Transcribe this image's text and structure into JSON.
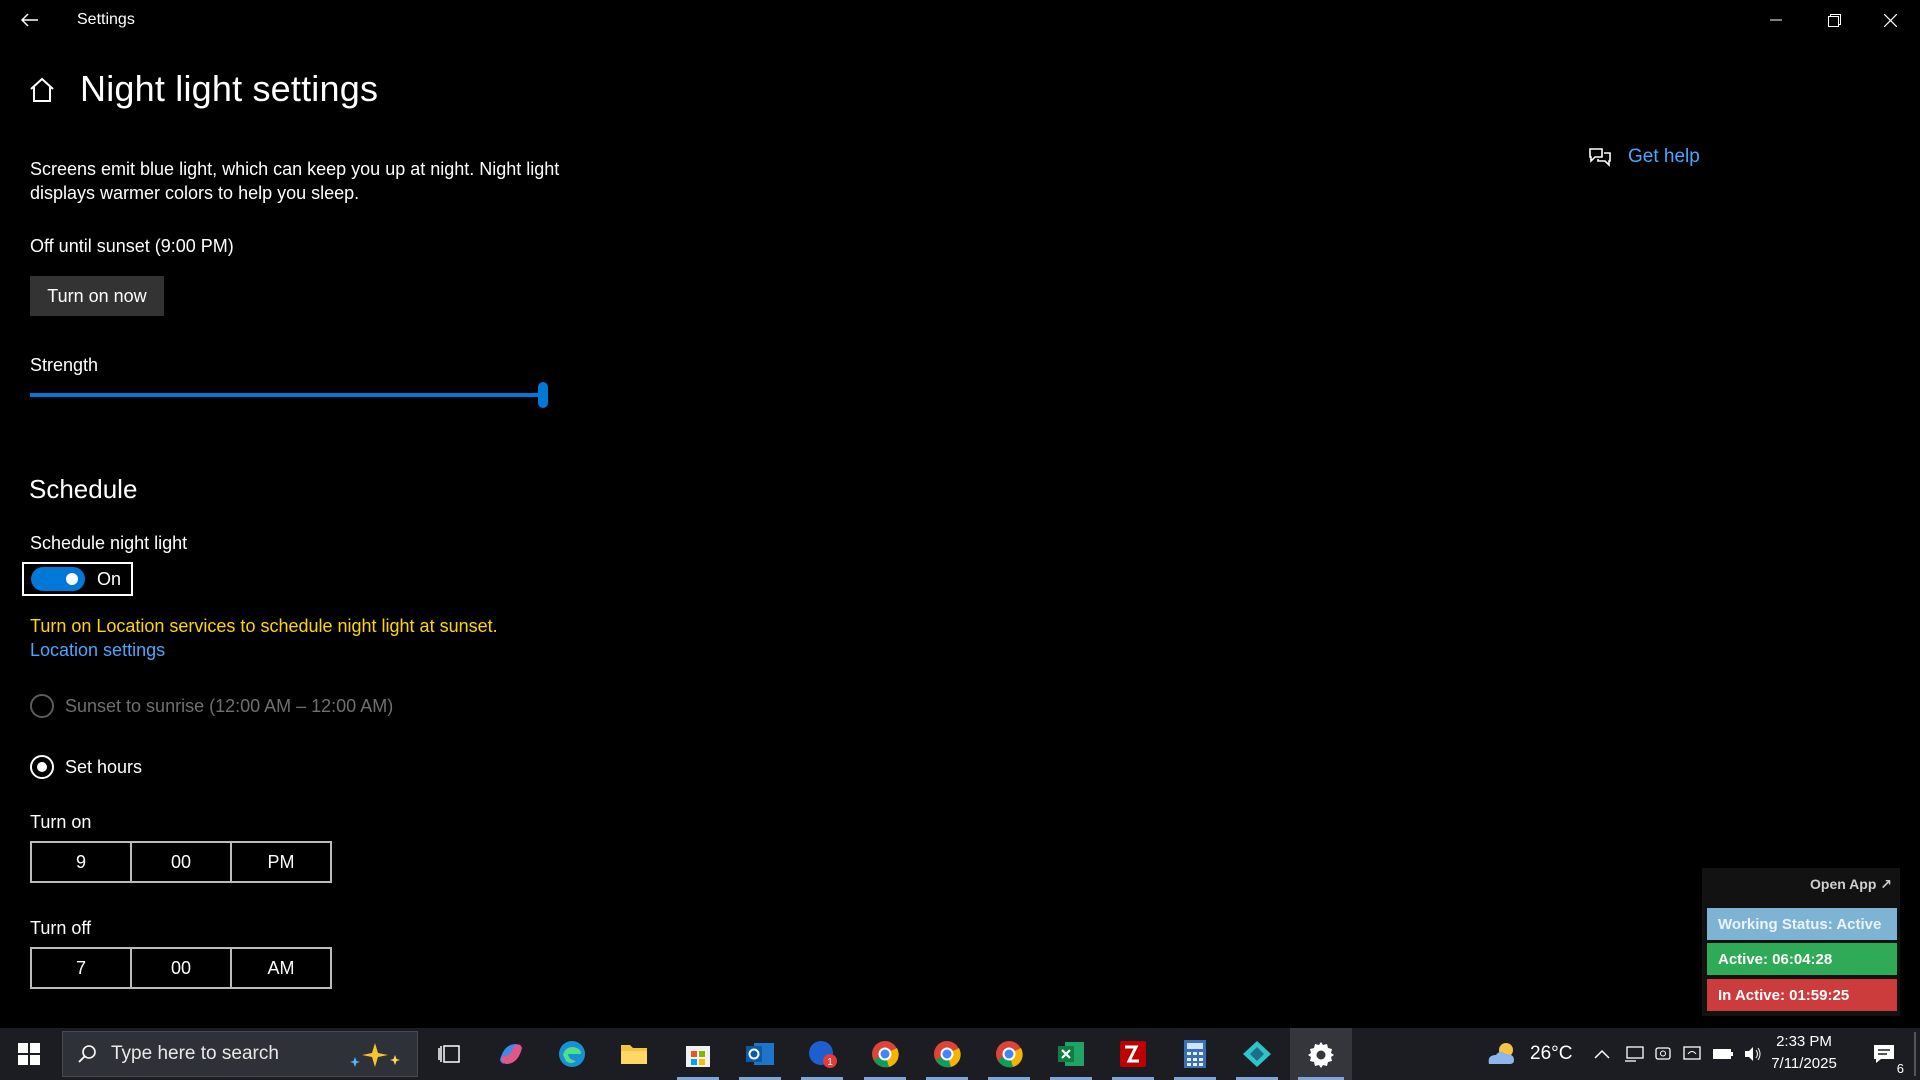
{
  "window": {
    "app_title": "Settings"
  },
  "header": {
    "page_title": "Night light settings"
  },
  "night_light": {
    "description_line1": "Screens emit blue light, which can keep you up at night. Night light",
    "description_line2": "displays warmer colors to help you sleep.",
    "status": "Off until sunset (9:00 PM)",
    "turn_on_button": "Turn on now",
    "strength_label": "Strength",
    "strength_value": 1.0
  },
  "schedule": {
    "heading": "Schedule",
    "toggle_label": "Schedule night light",
    "toggle_state": "On",
    "warning": "Turn on Location services to schedule night light at sunset.",
    "location_link": "Location settings",
    "option_sunset": "Sunset to sunrise (12:00 AM – 12:00 AM)",
    "option_set_hours": "Set hours",
    "turn_on": {
      "label": "Turn on",
      "hour": "9",
      "minute": "00",
      "period": "PM"
    },
    "turn_off": {
      "label": "Turn off",
      "hour": "7",
      "minute": "00",
      "period": "AM"
    }
  },
  "help": {
    "get_help": "Get help"
  },
  "widget": {
    "open_app": "Open App ↗",
    "working_status": "Working Status: Active",
    "active": "Active: 06:04:28",
    "inactive": "In Active: 01:59:25"
  },
  "taskbar": {
    "search_placeholder": "Type here to search",
    "weather_temp": "26°C",
    "time": "2:33 PM",
    "date": "7/11/2025",
    "notification_count": "6",
    "mail_badge": "1"
  },
  "colors": {
    "accent": "#0078d7",
    "link": "#4aa6ff",
    "warning": "#ffd700",
    "status_working": "#7fb3d3",
    "status_active": "#2faa56",
    "status_inactive": "#cc3c3c"
  }
}
